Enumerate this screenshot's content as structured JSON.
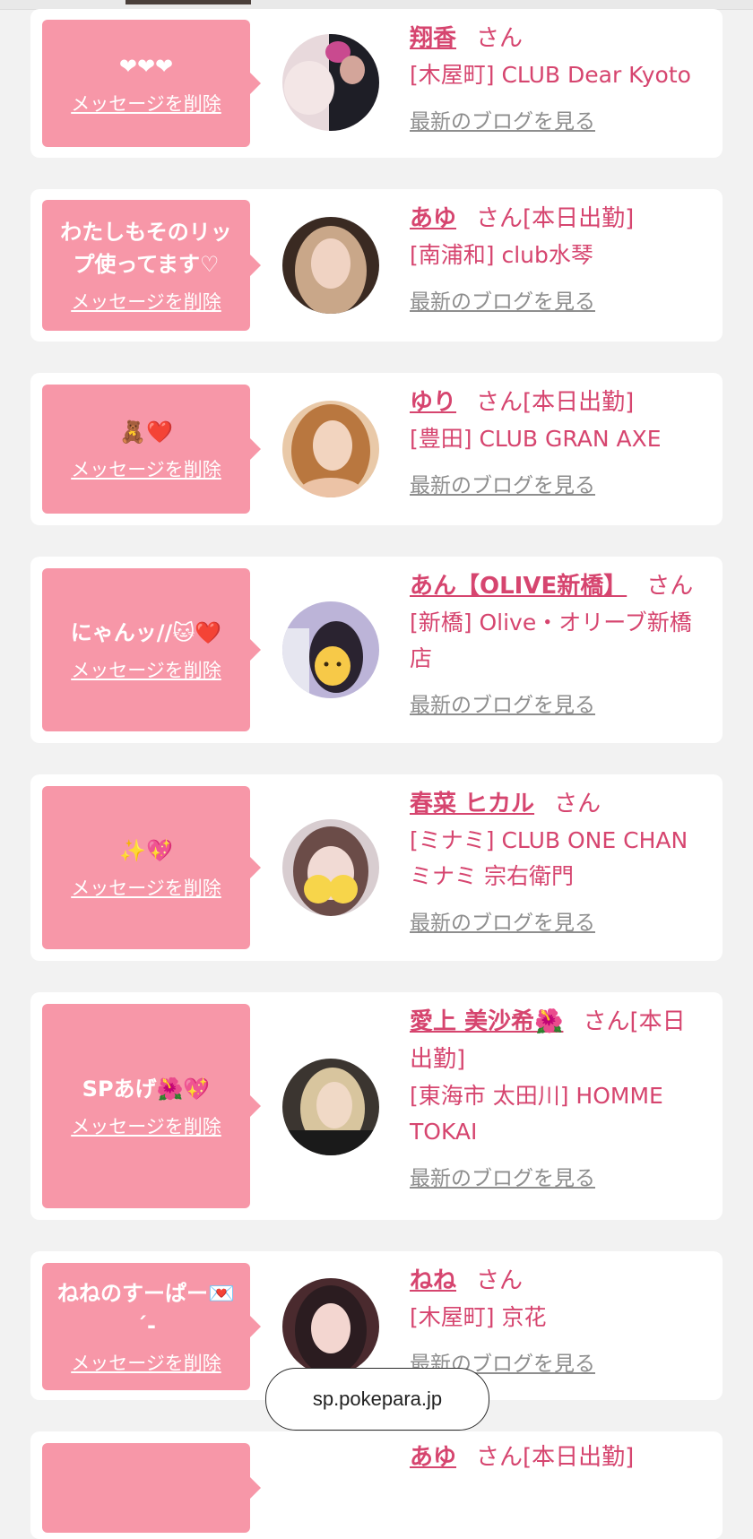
{
  "browser": {
    "url": "sp.pokepara.jp"
  },
  "colors": {
    "accent": "#d6456f",
    "bubble": "#f797a8",
    "link_gray": "#8e8e8e",
    "page_bg": "#f2f2f2"
  },
  "entries": [
    {
      "message": "❤❤❤",
      "delete_label": "メッセージを削除",
      "name": "翔香",
      "san": "さん",
      "status": "",
      "store": "[木屋町] CLUB Dear Kyoto",
      "blog_label": "最新のブログを見る"
    },
    {
      "message": "わたしもそのリップ使ってます♡",
      "delete_label": "メッセージを削除",
      "name": "あゆ",
      "san": "さん",
      "status": "[本日出勤]",
      "store": "[南浦和] club水琴",
      "blog_label": "最新のブログを見る"
    },
    {
      "message": "🧸❤️",
      "delete_label": "メッセージを削除",
      "name": "ゆり",
      "san": "さん",
      "status": "[本日出勤]",
      "store": "[豊田] CLUB GRAN AXE",
      "blog_label": "最新のブログを見る"
    },
    {
      "message": "にゃんッ//🐱❤️",
      "delete_label": "メッセージを削除",
      "name": "あん【OLIVE新橋】",
      "san": "さん",
      "status": "",
      "store": "[新橋] Olive・オリーブ新橋店",
      "blog_label": "最新のブログを見る"
    },
    {
      "message": "✨💖",
      "delete_label": "メッセージを削除",
      "name": "春菜 ヒカル",
      "san": "さん",
      "status": "",
      "store": "[ミナミ] CLUB ONE CHAN ミナミ 宗右衛門",
      "blog_label": "最新のブログを見る"
    },
    {
      "message": "SPあげ🌺💖",
      "delete_label": "メッセージを削除",
      "name": "愛上 美沙希🌺",
      "san": "さん",
      "status": "[本日出勤]",
      "store": "[東海市 太田川] HOMME TOKAI",
      "blog_label": "最新のブログを見る"
    },
    {
      "message": "ねねのすーぱー💌 ´-",
      "delete_label": "メッセージを削除",
      "name": "ねね",
      "san": "さん",
      "status": "",
      "store": "[木屋町] 京花",
      "blog_label": "最新のブログを見る"
    },
    {
      "message": "",
      "delete_label": "",
      "name": "あゆ",
      "san": "さん",
      "status": "[本日出勤]",
      "store": "",
      "blog_label": ""
    }
  ]
}
